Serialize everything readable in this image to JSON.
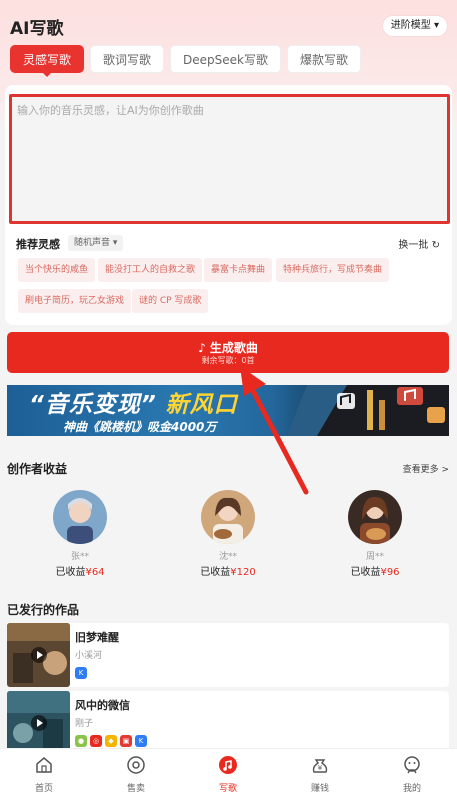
{
  "header": {
    "title": "AI写歌",
    "model_button": "进阶模型 ▾"
  },
  "tabs": [
    {
      "label": "灵感写歌",
      "active": true
    },
    {
      "label": "歌词写歌",
      "active": false
    },
    {
      "label": "DeepSeek写歌",
      "active": false
    },
    {
      "label": "爆款写歌",
      "active": false
    }
  ],
  "prompt": {
    "placeholder": "输入你的音乐灵感，让AI为你创作歌曲",
    "value": ""
  },
  "inspiration": {
    "title": "推荐灵感",
    "select_label": "随机声音 ▾",
    "refresh_label": "换一批",
    "chips": [
      "当个快乐的咸鱼",
      "能没打工人的自救之歌",
      "暴富卡点舞曲",
      "特种兵旅行，写成节奏曲",
      "刷电子简历，玩乙女游戏",
      "谜的 CP 写成歌"
    ]
  },
  "generate": {
    "label": "生成歌曲",
    "remaining": "剩余写歌：0首"
  },
  "banner": {
    "line1_a": "“音乐变现”",
    "line1_b": "新风口",
    "line2": "神曲《跳楼机》吸金4000万"
  },
  "earnings": {
    "title": "创作者收益",
    "see_more": "查看更多 >",
    "creators": [
      {
        "name": "张**",
        "earned_label": "已收益",
        "amount": "¥64"
      },
      {
        "name": "沈**",
        "earned_label": "已收益",
        "amount": "¥120"
      },
      {
        "name": "周**",
        "earned_label": "已收益",
        "amount": "¥96"
      }
    ]
  },
  "works": {
    "title": "已发行的作品",
    "items": [
      {
        "title": "旧梦难醒",
        "author": "小溪河"
      },
      {
        "title": "风中的微信",
        "author": "刚子"
      }
    ]
  },
  "tabbar": {
    "items": [
      {
        "label": "首页",
        "active": false
      },
      {
        "label": "售卖",
        "active": false
      },
      {
        "label": "写歌",
        "active": true
      },
      {
        "label": "赚钱",
        "active": false
      },
      {
        "label": "我的",
        "active": false
      }
    ]
  },
  "colors": {
    "accent": "#e8291f",
    "chip_text": "#d96a60",
    "chip_bg": "#fbeeee"
  }
}
